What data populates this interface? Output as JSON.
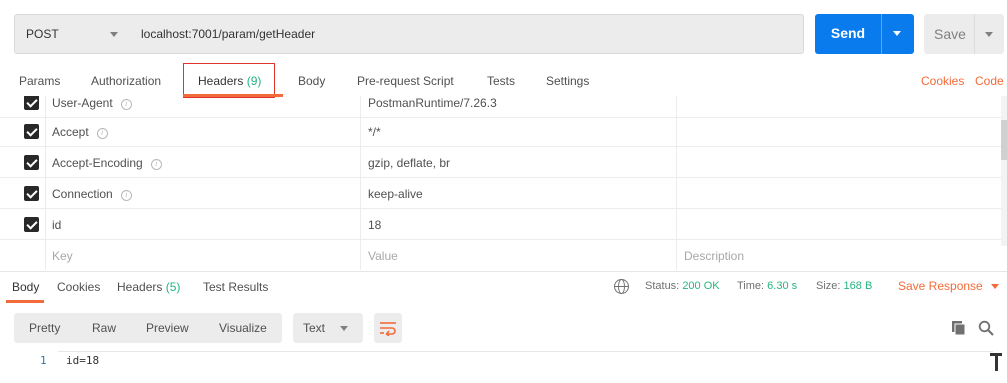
{
  "request": {
    "method": "POST",
    "url": "localhost:7001/param/getHeader",
    "send_label": "Send",
    "save_label": "Save"
  },
  "request_tabs": {
    "params": "Params",
    "authorization": "Authorization",
    "headers_label": "Headers",
    "headers_count": "(9)",
    "body": "Body",
    "prerequest": "Pre-request Script",
    "tests": "Tests",
    "settings": "Settings",
    "cookies": "Cookies",
    "code": "Code"
  },
  "headers": {
    "rows": [
      {
        "key": "User-Agent",
        "value": "PostmanRuntime/7.26.3",
        "checked": true,
        "info": "i"
      },
      {
        "key": "Accept",
        "value": "*/*",
        "checked": true,
        "info": "i"
      },
      {
        "key": "Accept-Encoding",
        "value": "gzip, deflate, br",
        "checked": true,
        "info": "i"
      },
      {
        "key": "Connection",
        "value": "keep-alive",
        "checked": true,
        "info": "i"
      },
      {
        "key": "id",
        "value": "18",
        "checked": true
      }
    ],
    "placeholder": {
      "key": "Key",
      "value": "Value",
      "description": "Description"
    }
  },
  "response_tabs": {
    "body": "Body",
    "cookies": "Cookies",
    "headers_label": "Headers",
    "headers_count": "(5)",
    "test_results": "Test Results"
  },
  "response_status": {
    "status_label": "Status:",
    "status_value": "200 OK",
    "time_label": "Time:",
    "time_value": "6.30 s",
    "size_label": "Size:",
    "size_value": "168 B",
    "save_response": "Save Response"
  },
  "view_toolbar": {
    "pretty": "Pretty",
    "raw": "Raw",
    "preview": "Preview",
    "visualize": "Visualize",
    "format": "Text"
  },
  "editor": {
    "lines": [
      {
        "no": "1",
        "text": "id=18"
      }
    ]
  },
  "colors": {
    "accent": "#f26b3a",
    "send": "#097bed",
    "success": "#26b47f"
  }
}
